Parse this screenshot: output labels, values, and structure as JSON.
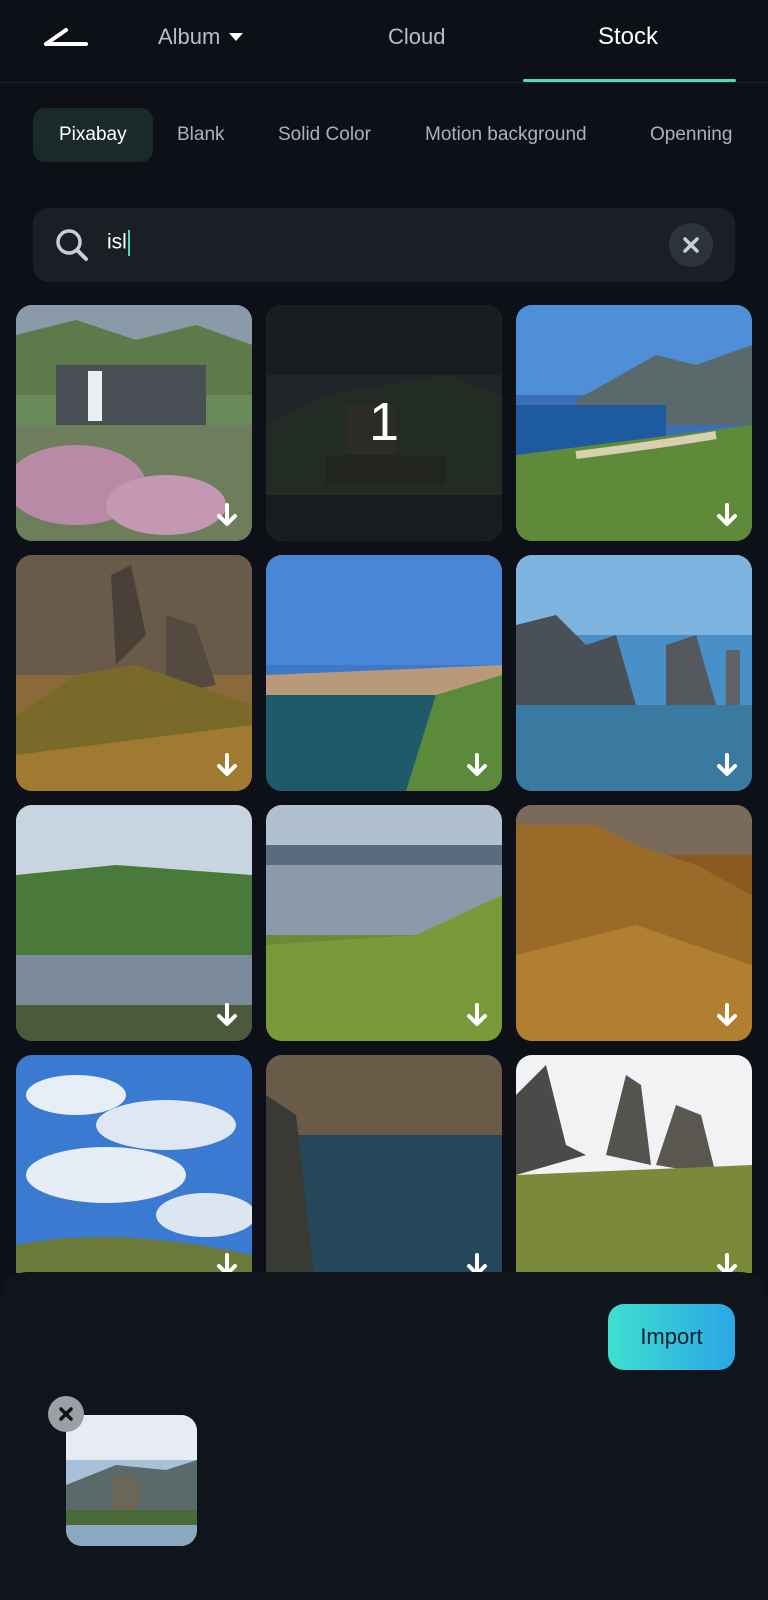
{
  "header": {
    "tabs": [
      {
        "label": "Album"
      },
      {
        "label": "Cloud"
      },
      {
        "label": "Stock"
      }
    ],
    "active_tab": "Stock",
    "back_icon": "back-arrow-icon",
    "album_dropdown_icon": "caret-down-icon"
  },
  "categories": [
    {
      "label": "Pixabay"
    },
    {
      "label": "Blank"
    },
    {
      "label": "Solid Color"
    },
    {
      "label": "Motion background"
    },
    {
      "label": "Openning"
    }
  ],
  "active_category": "Pixabay",
  "search": {
    "value": "isl",
    "search_icon": "search-icon",
    "clear_icon": "clear-icon"
  },
  "results": {
    "selected_badge": "1",
    "download_icon": "download-icon",
    "count": 12
  },
  "bottom": {
    "import_label": "Import",
    "remove_icon": "close-icon"
  },
  "colors": {
    "accent": "#55d8bb",
    "background": "#0d1117",
    "import_gradient_start": "#3fe0d0",
    "import_gradient_end": "#2aa6e6"
  }
}
